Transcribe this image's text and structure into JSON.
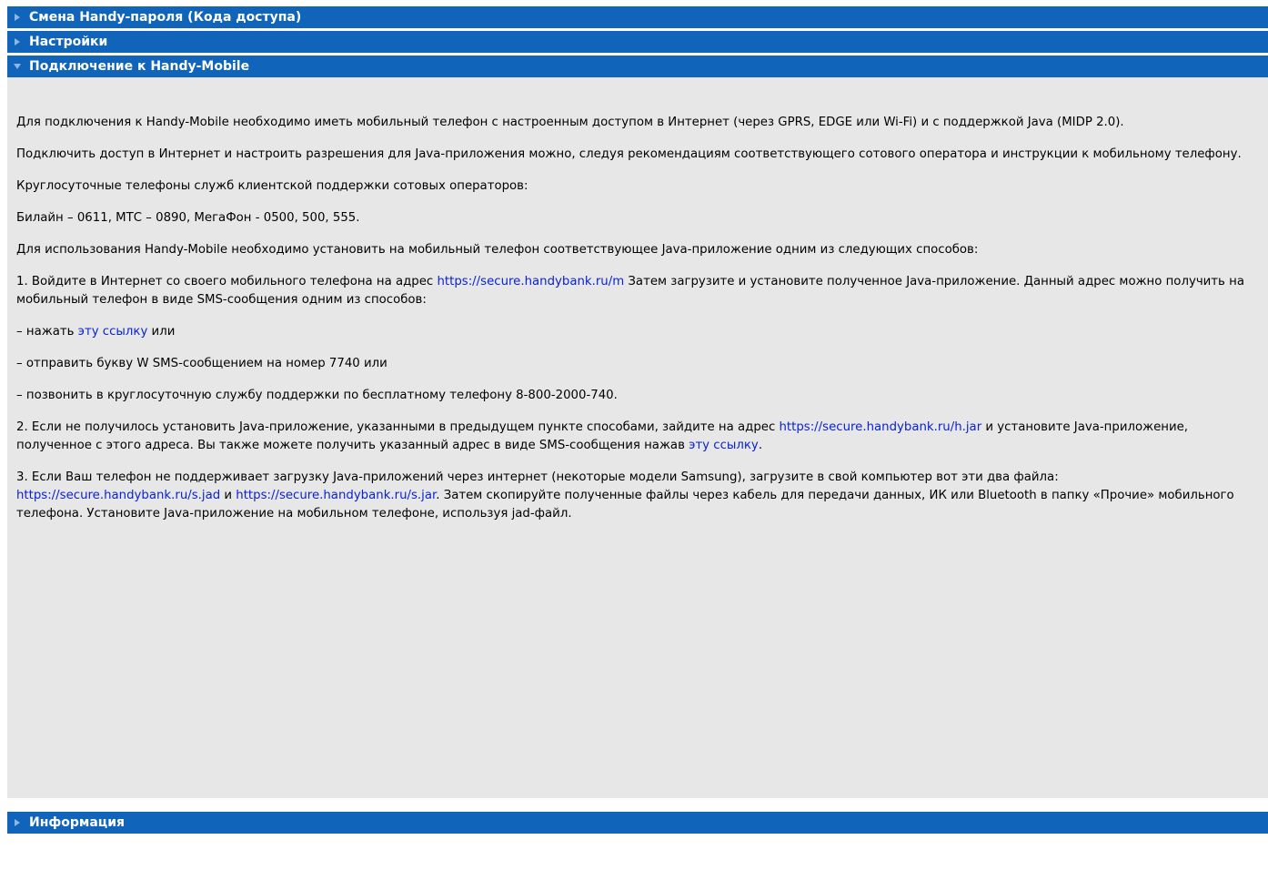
{
  "colors": {
    "bar": "#1064b9",
    "arrow": "#8fb6e4",
    "link": "#0a22d6",
    "panel": "#e7e7e7"
  },
  "sections": [
    {
      "title": "Смена Handy-пароля (Кода доступа)",
      "icon": "triangle-right-icon"
    },
    {
      "title": "Настройки",
      "icon": "triangle-right-icon"
    },
    {
      "title": "Подключение к Handy-Mobile",
      "icon": "triangle-down-icon"
    },
    {
      "title": "Информация",
      "icon": "triangle-right-icon"
    }
  ],
  "content": {
    "p1": "Для подключения к Handy-Mobile необходимо иметь мобильный телефон с настроенным доступом в Интернет (через GPRS, EDGE или Wi-Fi) и с поддержкой Java (MIDP 2.0).",
    "p2": "Подключить доступ в Интернет и настроить разрешения для Java-приложения можно, следуя рекомендациям соответствующего сотового оператора и инструкции к мобильному телефону.",
    "p3": "Круглосуточные телефоны служб клиентской поддержки сотовых операторов:",
    "p4": "Билайн – 0611, МТС – 0890, МегаФон - 0500, 500, 555.",
    "p5": "Для использования Handy-Mobile необходимо установить на мобильный телефон соответствующее Java-приложение одним из следующих способов:",
    "p6_a": "1. Войдите в Интернет со своего мобильного телефона на адрес ",
    "p6_link": "https://secure.handybank.ru/m",
    "p6_b": " Затем загрузите и установите полученное Java-приложение. Данный адрес можно получить на мобильный телефон в виде SMS-сообщения одним из способов:",
    "p7_a": "– нажать ",
    "p7_link": "эту ссылку",
    "p7_b": " или",
    "p8": "– отправить букву W SMS-сообщением на номер 7740 или",
    "p9": "– позвонить в круглосуточную службу поддержки по бесплатному телефону 8-800-2000-740.",
    "p10_a": "2. Если не получилось установить Java-приложение, указанными в предыдущем пункте способами, зайдите на адрес ",
    "p10_link1": "https://secure.handybank.ru/h.jar",
    "p10_b": " и установите Java-приложение, полученное с этого адреса. Вы также можете получить указанный адрес в виде SMS-сообщения нажав ",
    "p10_link2": "эту ссылку",
    "p10_c": ".",
    "p11_a": "3. Если Ваш телефон не поддерживает загрузку Java-приложений через интернет (некоторые модели Samsung), загрузите в свой компьютер вот эти два файла: ",
    "p11_link1": "https://secure.handybank.ru/s.jad",
    "p11_b": " и ",
    "p11_link2": "https://secure.handybank.ru/s.jar",
    "p11_c": ". Затем скопируйте полученные файлы через кабель для передачи данных, ИК или Bluetooth в папку «Прочие» мобильного телефона. Установите Java-приложение на мобильном телефоне, используя jad-файл."
  }
}
